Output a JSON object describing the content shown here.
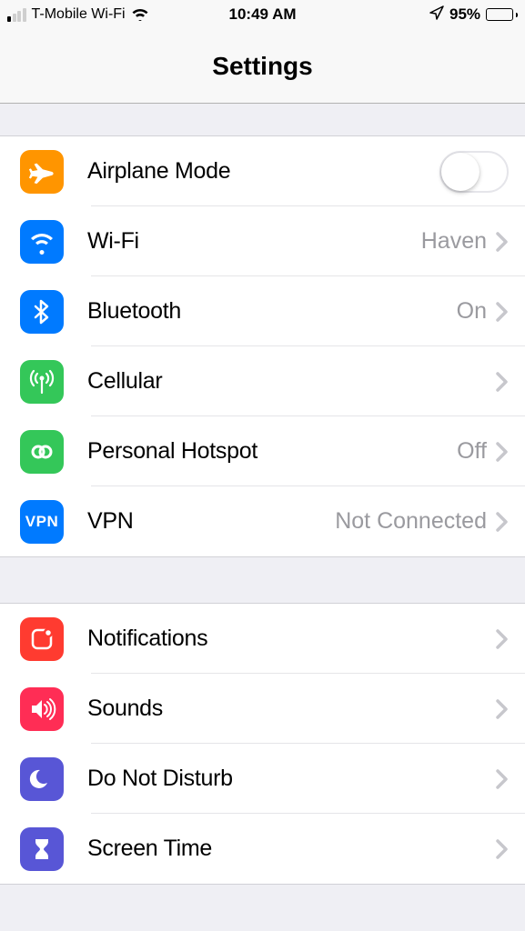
{
  "status": {
    "carrier": "T-Mobile Wi-Fi",
    "time": "10:49 AM",
    "battery_percent": "95%"
  },
  "nav": {
    "title": "Settings"
  },
  "groups": [
    {
      "rows": [
        {
          "label": "Airplane Mode",
          "value": "",
          "type": "toggle",
          "icon": "airplane"
        },
        {
          "label": "Wi-Fi",
          "value": "Haven",
          "type": "link",
          "icon": "wifi"
        },
        {
          "label": "Bluetooth",
          "value": "On",
          "type": "link",
          "icon": "bluetooth"
        },
        {
          "label": "Cellular",
          "value": "",
          "type": "link",
          "icon": "cellular"
        },
        {
          "label": "Personal Hotspot",
          "value": "Off",
          "type": "link",
          "icon": "hotspot"
        },
        {
          "label": "VPN",
          "value": "Not Connected",
          "type": "link",
          "icon": "vpn"
        }
      ]
    },
    {
      "rows": [
        {
          "label": "Notifications",
          "value": "",
          "type": "link",
          "icon": "notifications"
        },
        {
          "label": "Sounds",
          "value": "",
          "type": "link",
          "icon": "sounds"
        },
        {
          "label": "Do Not Disturb",
          "value": "",
          "type": "link",
          "icon": "dnd"
        },
        {
          "label": "Screen Time",
          "value": "",
          "type": "link",
          "icon": "screentime"
        }
      ]
    }
  ]
}
